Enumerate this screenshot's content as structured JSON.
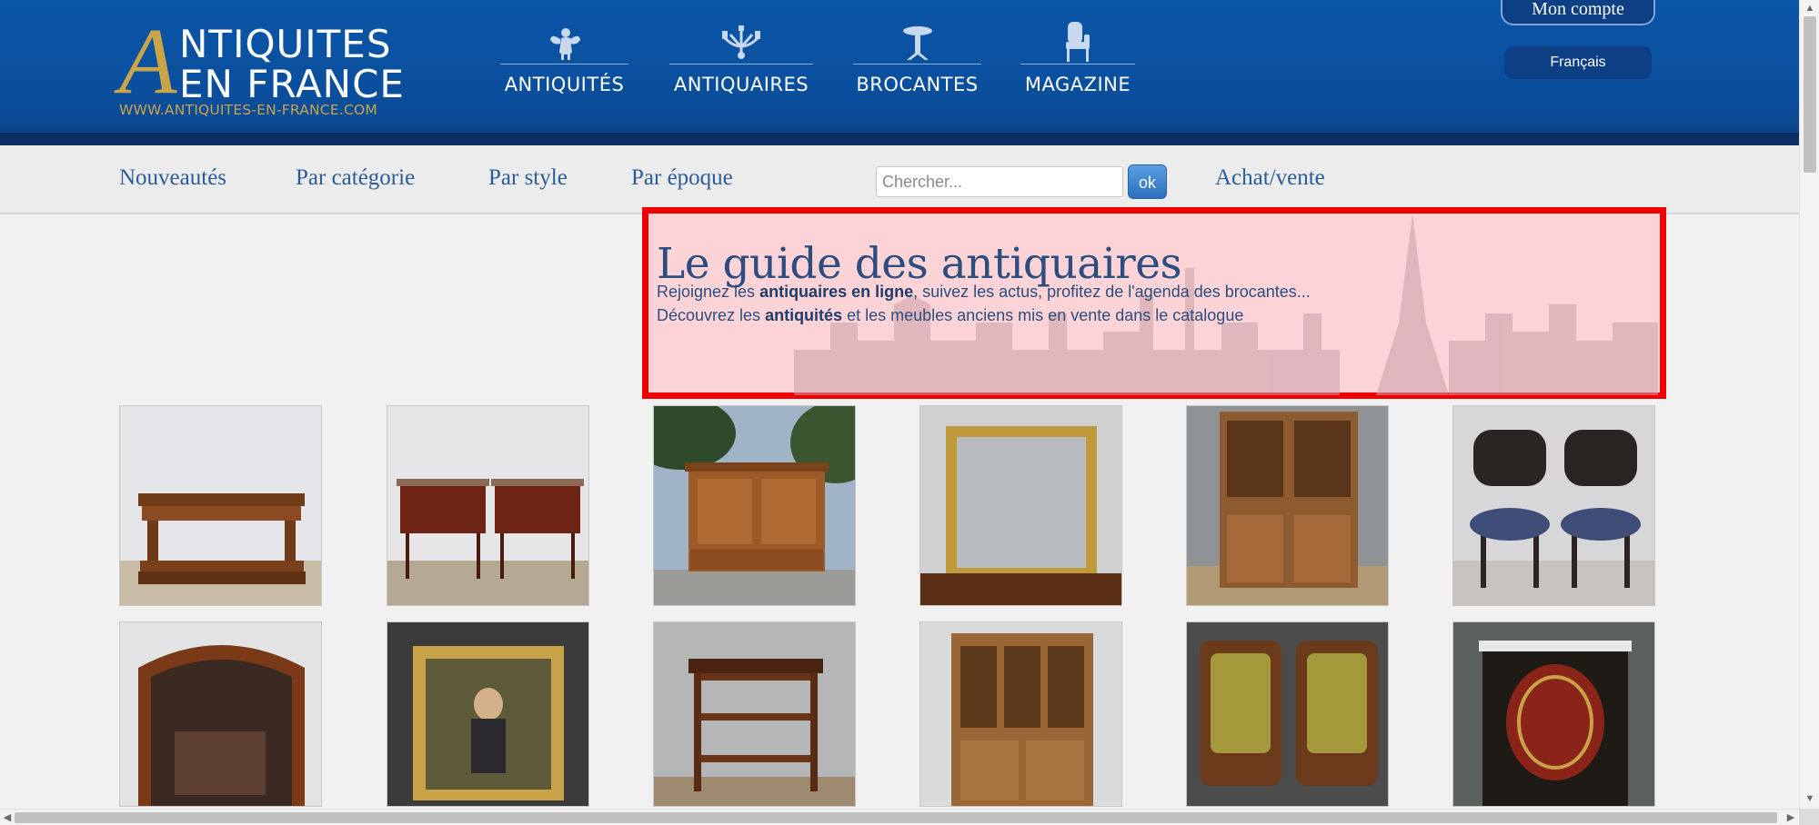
{
  "brand": {
    "logo_initial": "A",
    "logo_line1": "NTIQUITES",
    "logo_line2": "EN FRANCE",
    "logo_url": "WWW.ANTIQUITES-EN-FRANCE.COM",
    "accent_color": "#c9a548",
    "header_color": "#0b56a8"
  },
  "topnav": [
    {
      "label": "ANTIQUITÉS",
      "icon": "angel-icon"
    },
    {
      "label": "ANTIQUAIRES",
      "icon": "chandelier-icon"
    },
    {
      "label": "BROCANTES",
      "icon": "pedestal-table-icon"
    },
    {
      "label": "MAGAZINE",
      "icon": "armchair-icon"
    }
  ],
  "account": {
    "label": "Mon compte"
  },
  "language": {
    "label": "Français"
  },
  "subnav": {
    "items": [
      "Nouveautés",
      "Par catégorie",
      "Par style",
      "Par époque"
    ],
    "search_placeholder": "Chercher...",
    "search_button": "ok",
    "trade_link": "Achat/vente"
  },
  "hero": {
    "title": "Le guide des antiquaires",
    "line1_pre": "Rejoignez les ",
    "line1_bold": "antiquaires en ligne",
    "line1_post": ", suivez les actus, profitez de l'agenda des brocantes...",
    "line2_pre": "Découvrez les ",
    "line2_bold": "antiquités",
    "line2_post": " et les meubles anciens mis en vente dans le catalogue"
  },
  "products": [
    {
      "name": "console-table-photo"
    },
    {
      "name": "pair-nightstands-photo"
    },
    {
      "name": "armoire-photo"
    },
    {
      "name": "gilt-mirror-photo"
    },
    {
      "name": "bookcase-cabinet-photo"
    },
    {
      "name": "pair-black-chairs-photo"
    },
    {
      "name": "overmantel-mirror-photo"
    },
    {
      "name": "framed-painting-photo"
    },
    {
      "name": "server-buffet-photo"
    },
    {
      "name": "glass-bookcase-photo"
    },
    {
      "name": "pair-armchairs-photo"
    },
    {
      "name": "boulle-cabinet-photo"
    }
  ]
}
